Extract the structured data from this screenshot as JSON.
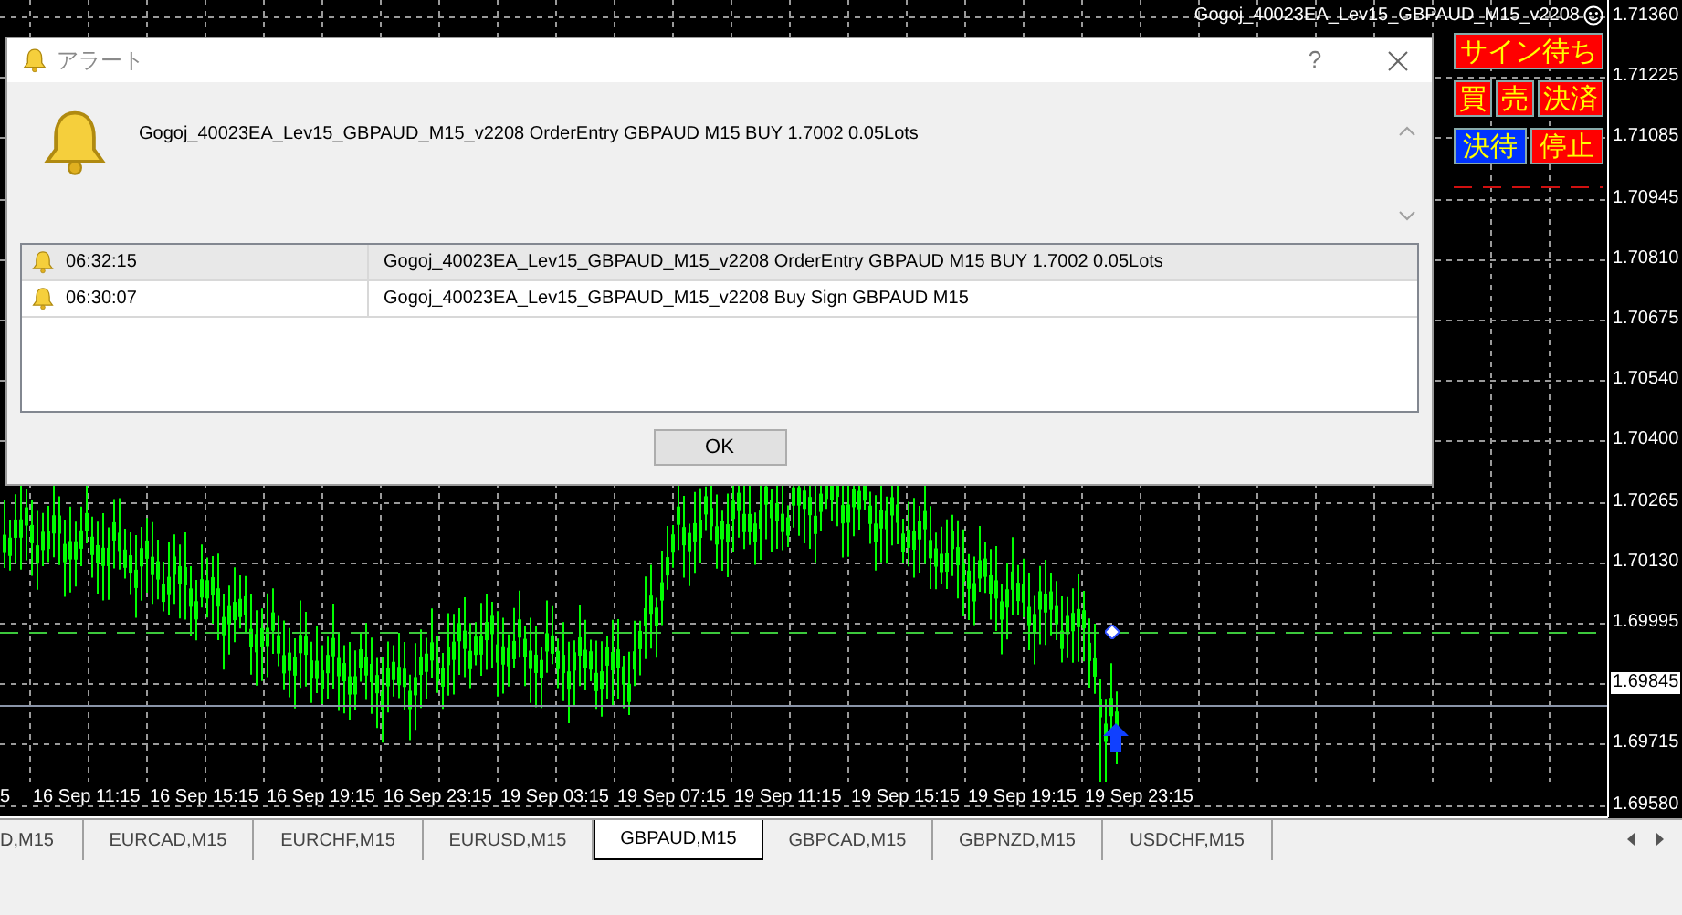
{
  "chart": {
    "expert_title": "Gogoj_40023EA_Lev15_GBPAUD_M15_v2208",
    "panel_rows": [
      [
        {
          "label": "サイン待ち",
          "color": "#ff0000"
        }
      ],
      [
        {
          "label": "買",
          "color": "#ff0000"
        },
        {
          "label": "売",
          "color": "#ff0000"
        },
        {
          "label": "決済",
          "color": "#ff0000"
        }
      ],
      [
        {
          "label": "決待",
          "color": "#0033ff"
        },
        {
          "label": "停止",
          "color": "#ff0000"
        }
      ]
    ],
    "price_labels": [
      {
        "label": "1.71360",
        "current": false
      },
      {
        "label": "1.71225",
        "current": false
      },
      {
        "label": "1.71085",
        "current": false
      },
      {
        "label": "1.70945",
        "current": false
      },
      {
        "label": "1.70810",
        "current": false
      },
      {
        "label": "1.70675",
        "current": false
      },
      {
        "label": "1.70540",
        "current": false
      },
      {
        "label": "1.70400",
        "current": false
      },
      {
        "label": "1.70265",
        "current": false
      },
      {
        "label": "1.70130",
        "current": false
      },
      {
        "label": "1.69995",
        "current": false
      },
      {
        "label": "1.69845",
        "current": true
      },
      {
        "label": "1.69715",
        "current": false
      },
      {
        "label": "1.69580",
        "current": false
      }
    ],
    "time_labels": [
      "5",
      "16 Sep 11:15",
      "16 Sep 15:15",
      "16 Sep 19:15",
      "16 Sep 23:15",
      "19 Sep 03:15",
      "19 Sep 07:15",
      "19 Sep 11:15",
      "19 Sep 15:15",
      "19 Sep 19:15",
      "19 Sep 23:15"
    ]
  },
  "alert_dialog": {
    "title": "アラート",
    "help": "?",
    "message": "Gogoj_40023EA_Lev15_GBPAUD_M15_v2208  OrderEntry GBPAUD M15 BUY 1.7002 0.05Lots",
    "rows": [
      {
        "time": "06:32:15",
        "message": "Gogoj_40023EA_Lev15_GBPAUD_M15_v2208  OrderEntry GBPAUD M15 BUY 1.7002 0.05Lots",
        "selected": true
      },
      {
        "time": "06:30:07",
        "message": "Gogoj_40023EA_Lev15_GBPAUD_M15_v2208 Buy Sign GBPAUD M15",
        "selected": false
      }
    ],
    "ok_button": "OK"
  },
  "symbol_tabs": [
    {
      "label": "D,M15",
      "selected": false
    },
    {
      "label": "EURCAD,M15",
      "selected": false
    },
    {
      "label": "EURCHF,M15",
      "selected": false
    },
    {
      "label": "EURUSD,M15",
      "selected": false
    },
    {
      "label": "GBPAUD,M15",
      "selected": true
    },
    {
      "label": "GBPCAD,M15",
      "selected": false
    },
    {
      "label": "GBPNZD,M15",
      "selected": false
    },
    {
      "label": "USDCHF,M15",
      "selected": false
    }
  ]
}
